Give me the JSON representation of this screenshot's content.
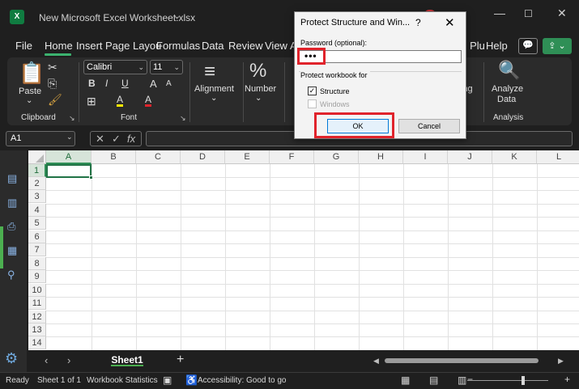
{
  "window": {
    "title": "New Microsoft Excel Worksheet.xlsx",
    "logo_text": "X",
    "title_chevron": "⌄",
    "minimize": "—",
    "maximize": "☐",
    "close": "✕"
  },
  "menu": {
    "tabs": [
      "File",
      "Home",
      "Insert",
      "Page Layou",
      "Formulas",
      "Data",
      "Review",
      "View",
      "A",
      "s Plu",
      "Help"
    ],
    "active": "Home",
    "comments_icon": "💬",
    "share_icon": "⇪ ⌄"
  },
  "ribbon": {
    "clipboard": {
      "paste_label": "Paste",
      "group_label": "Clipboard",
      "paste_chevron": "⌄",
      "cut_icon": "✂",
      "copy_icon": "⎘",
      "format_painter_icon": "🖌"
    },
    "font": {
      "font_name": "Calibri",
      "font_size": "11",
      "bold": "B",
      "italic": "I",
      "underline": "U",
      "increase_size": "A",
      "decrease_size": "A",
      "borders_icon": "⊞",
      "fill_icon": "A",
      "font_color_icon": "A",
      "group_label": "Font"
    },
    "alignment": {
      "label": "Alignment",
      "icon": "≡"
    },
    "number": {
      "label": "Number",
      "icon": "%"
    },
    "editing_partial_label": "ing",
    "analyze": {
      "label_line1": "Analyze",
      "label_line2": "Data",
      "group_label": "Analysis",
      "icon": "🔍"
    },
    "dialog_launcher_icon": "↘"
  },
  "formula_bar": {
    "name_box": "A1",
    "cancel_icon": "✕",
    "enter_icon": "✓",
    "fx_icon": "fx",
    "formula_value": ""
  },
  "grid": {
    "columns": [
      "A",
      "B",
      "C",
      "D",
      "E",
      "F",
      "G",
      "H",
      "I",
      "J",
      "K",
      "L"
    ],
    "rows": [
      "1",
      "2",
      "3",
      "4",
      "5",
      "6",
      "7",
      "8",
      "9",
      "10",
      "11",
      "12",
      "13",
      "14"
    ],
    "active_cell": "A1"
  },
  "sidebar_icons": [
    "form-icon",
    "comments-icon",
    "print-icon",
    "table-icon",
    "binoculars-icon",
    "settings-icon"
  ],
  "sheets": {
    "tabs": [
      "Sheet1"
    ],
    "active": "Sheet1",
    "prev": "‹",
    "next": "›",
    "add": "+"
  },
  "status": {
    "ready": "Ready",
    "sheet_position": "Sheet 1 of 1",
    "workbook_statistics": "Workbook Statistics",
    "accessibility": "Accessibility: Good to go"
  },
  "dialog": {
    "title": "Protect Structure and Win...",
    "help": "?",
    "close": "✕",
    "password_label": "Password (optional):",
    "password_value": "•••",
    "protect_for_label": "Protect workbook for",
    "structure_label": "Structure",
    "structure_checked": true,
    "windows_label": "Windows",
    "windows_checked": false,
    "windows_disabled": true,
    "ok_label": "OK",
    "cancel_label": "Cancel",
    "check_mark": "✓"
  },
  "colors": {
    "accent_green": "#217346",
    "highlight_red": "#e0232b",
    "ok_border": "#0078d7"
  }
}
